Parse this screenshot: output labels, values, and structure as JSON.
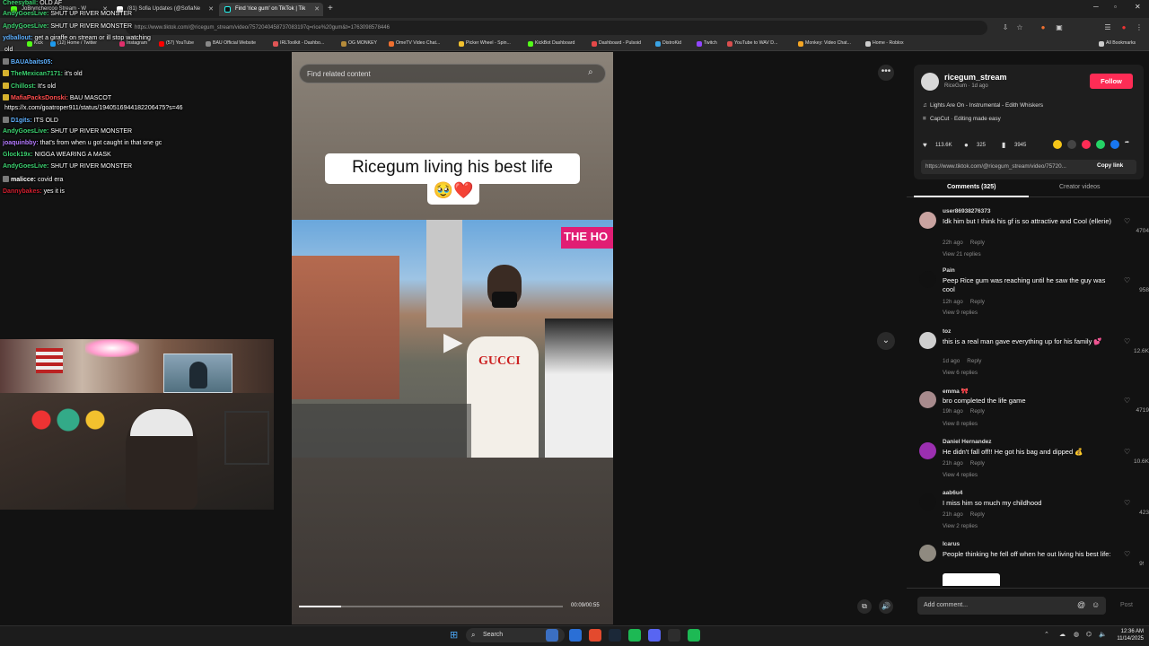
{
  "browser": {
    "tabs": [
      {
        "label": "JoBrynchercoo Stream - W",
        "active": false
      },
      {
        "label": "(81) Sofia Updates (@SofiaNe",
        "active": false
      },
      {
        "label": "Find 'rice gum' on TikTok | Tik",
        "active": true
      }
    ],
    "url": "https://www.tiktok.com/@ricegum_stream/video/7572040458737083197q=rice%20gum&t=1763098578446",
    "bookmarks": [
      {
        "label": "Kick",
        "color": "#53fc18"
      },
      {
        "label": "(12) Home / Twitter",
        "color": "#1d9bf0"
      },
      {
        "label": "Instagram",
        "color": "#e1306c"
      },
      {
        "label": "(57) YouTube",
        "color": "#ff0000"
      },
      {
        "label": "BAU Official Website",
        "color": "#888888"
      },
      {
        "label": "IRLToolkit - Dashbo...",
        "color": "#e05555"
      },
      {
        "label": "OG MONKEY",
        "color": "#b58b3a"
      },
      {
        "label": "OmeTV Video Chat...",
        "color": "#f07030"
      },
      {
        "label": "Picker Wheel - Spin...",
        "color": "#f2c12e"
      },
      {
        "label": "KickBot Dashboard",
        "color": "#53fc18"
      },
      {
        "label": "Dashboard - Pulsoid",
        "color": "#e54848"
      },
      {
        "label": "DistroKid",
        "color": "#3aa3e3"
      },
      {
        "label": "Twitch",
        "color": "#9146ff"
      },
      {
        "label": "YouTube to WAV D...",
        "color": "#d94e4e"
      },
      {
        "label": "Monkey: Video Chat...",
        "color": "#f5a623"
      },
      {
        "label": "Home - Roblox",
        "color": "#cccccc"
      }
    ],
    "all_bookmarks": "All Bookmarks"
  },
  "chat": [
    {
      "user": "Cheesyball:",
      "msg": "OLD AF",
      "color": "#3bd16f",
      "badge": ""
    },
    {
      "user": "AndyGoesLive:",
      "msg": "SHUT UP RIVER MONSTER",
      "color": "#3bd16f",
      "badge": ""
    },
    {
      "user": "AndyGoesLive:",
      "msg": "SHUT UP RIVER MONSTER",
      "color": "#3bd16f",
      "badge": ""
    },
    {
      "user": "ydballout:",
      "msg": "get a giraffe on stream or ill stop watching",
      "color": "#5fb1ff",
      "badge": ""
    },
    {
      "user": "",
      "msg": "old",
      "color": "#ff4d4d",
      "badge": ""
    },
    {
      "user": "BAUAbaits05:",
      "msg": "",
      "color": "#5fb1ff",
      "badge": "#7a7a7a"
    },
    {
      "user": "TheMexican7171:",
      "msg": "it's old",
      "color": "#3bd16f",
      "badge": "#d6b22e"
    },
    {
      "user": "Chillost:",
      "msg": "It's old",
      "color": "#3bd16f",
      "badge": "#d6b22e"
    },
    {
      "user": "MafiaPacksDonski:",
      "msg": "BAU MASCOT",
      "color": "#ff4d4d",
      "badge": "#d6b22e"
    },
    {
      "user": "",
      "msg": "https://x.com/goatroper911/status/1940516944182206475?s=46",
      "color": "#ffffff",
      "badge": ""
    },
    {
      "user": "D1gits:",
      "msg": "ITS OLD",
      "color": "#5fb1ff",
      "badge": "#7a7a7a"
    },
    {
      "user": "AndyGoesLive:",
      "msg": "SHUT UP RIVER MONSTER",
      "color": "#3bd16f",
      "badge": ""
    },
    {
      "user": "joaquinbby:",
      "msg": "that's from when u got caught in that one gc",
      "color": "#b57aff",
      "badge": ""
    },
    {
      "user": "Glock19x:",
      "msg": "NIGGA WEARING A MASK",
      "color": "#3bd16f",
      "badge": ""
    },
    {
      "user": "AndyGoesLive:",
      "msg": "SHUT UP RIVER MONSTER",
      "color": "#3bd16f",
      "badge": ""
    },
    {
      "user": "malicce:",
      "msg": "covid era",
      "color": "#ffffff",
      "badge": "#7a7a7a"
    },
    {
      "user": "Dannybakes:",
      "msg": "yes it is",
      "color": "#d11f2f",
      "badge": ""
    }
  ],
  "tiktok": {
    "search_placeholder": "Find related content",
    "caption_line1": "Ricegum living his best life",
    "caption_line2": "🥹❤️",
    "video_overlay_text": "THE HO",
    "video_shirt_text": "GUCCI",
    "timecode": "00:09/00:55",
    "progress": 0.16,
    "author": {
      "username": "ricegum_stream",
      "display": "RiceGum · 1d ago",
      "follow_label": "Follow"
    },
    "music": "Lights Are On - Instrumental - Edith Whiskers",
    "capcut": "CapCut · Editing made easy",
    "stats": {
      "likes": "113.6K",
      "comments": "325",
      "saves": "3945"
    },
    "share_colors": [
      "#f5c518",
      "#444444",
      "#fe2c55",
      "#25d366",
      "#1877f2",
      "#dddddd"
    ],
    "link": "https://www.tiktok.com/@ricegum_stream/video/75720...",
    "copy_link": "Copy link",
    "tab_comments": "Comments (325)",
    "tab_creator": "Creator videos",
    "comments": [
      {
        "user": "user86938276373",
        "text": "Idk him but I think his gf is so attractive and Cool (ellerie)",
        "meta": "22h ago",
        "reply": "Reply",
        "replies": "View 21 replies",
        "likes": "4704",
        "avatar": "#c9a3a0"
      },
      {
        "user": "Pain",
        "text": "Peep Rice gum was reaching until he saw the guy was cool",
        "meta": "12h ago",
        "reply": "Reply",
        "replies": "View 9 replies",
        "likes": "958",
        "avatar": "#111111"
      },
      {
        "user": "toz",
        "text": "this is a real man gave everything up for his family 💕",
        "meta": "1d ago",
        "reply": "Reply",
        "replies": "View 6 replies",
        "likes": "12.6K",
        "avatar": "#cfcfcf"
      },
      {
        "user": "emma 🎀",
        "text": "bro completed the life game",
        "meta": "19h ago",
        "reply": "Reply",
        "replies": "View 8 replies",
        "likes": "4719",
        "avatar": "#a78a8c"
      },
      {
        "user": "Daniel Hernandez",
        "text": "He didn't fall off!! He got his bag and dipped 💰",
        "meta": "21h ago",
        "reply": "Reply",
        "replies": "View 4 replies",
        "likes": "10.6K",
        "avatar": "#9b2fb0"
      },
      {
        "user": "aab6u4",
        "text": "I miss him so much my childhood",
        "meta": "21h ago",
        "reply": "Reply",
        "replies": "View 2 replies",
        "likes": "423",
        "avatar": "#111111"
      },
      {
        "user": "Icarus",
        "text": "People thinking he fell off when he out living his best life:",
        "meta": "",
        "reply": "",
        "replies": "",
        "likes": "992",
        "avatar": "#8f8a80"
      }
    ],
    "add_comment_placeholder": "Add comment...",
    "post_label": "Post"
  },
  "taskbar": {
    "search_label": "Search",
    "time": "12:36 AM",
    "date": "11/14/2025",
    "app_colors": [
      "#2a6fd6",
      "#e34a2e",
      "#1b2838",
      "#1db954",
      "#5865f2",
      "#2d2d2d",
      "#1db954",
      "#5865f2"
    ]
  }
}
